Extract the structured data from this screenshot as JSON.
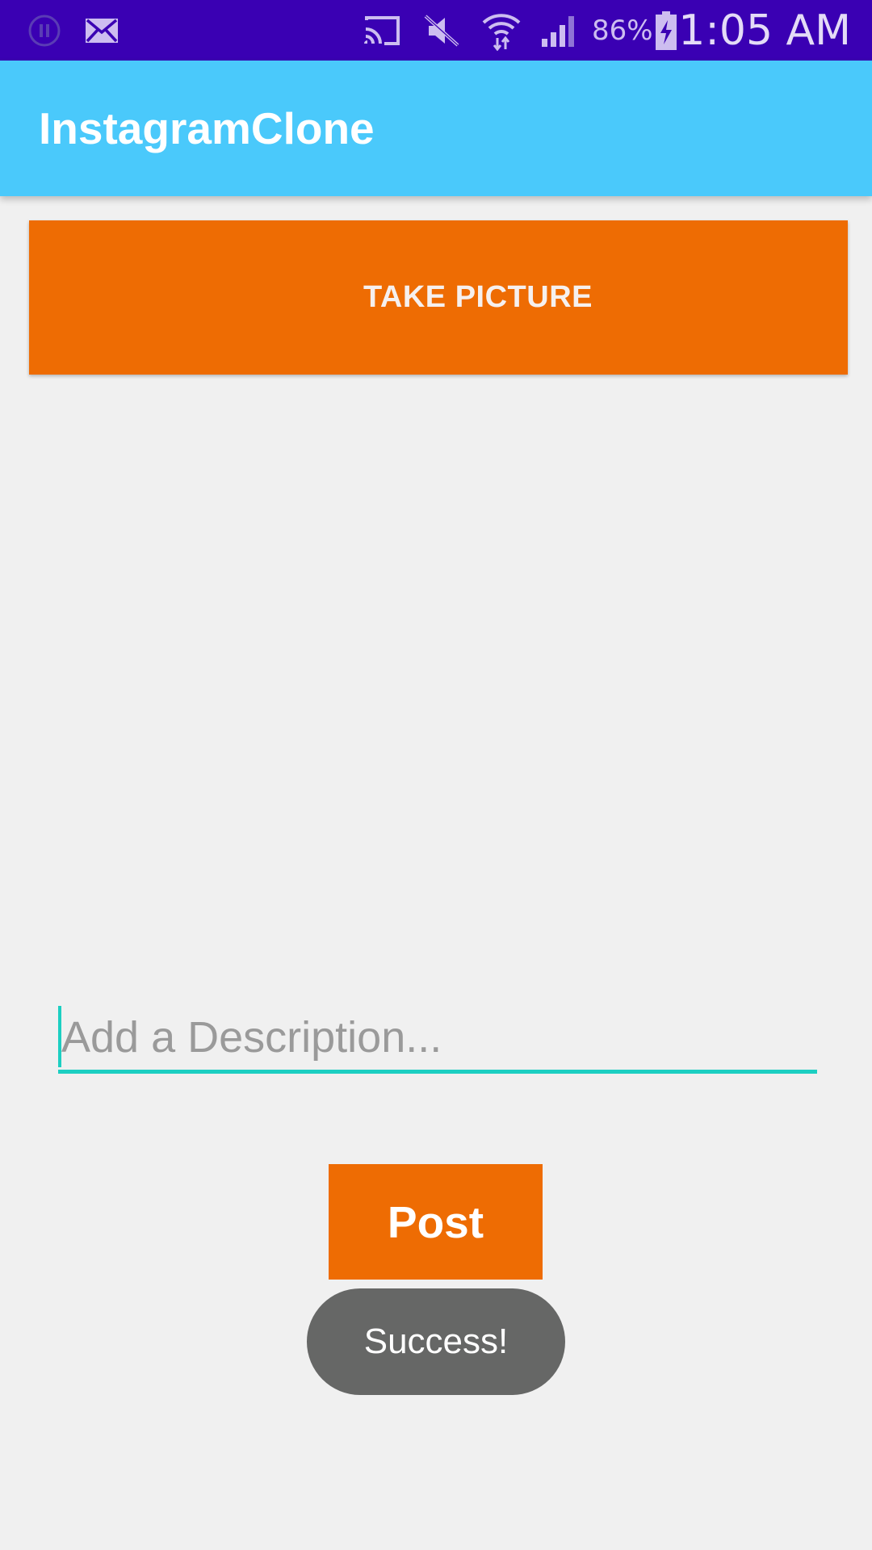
{
  "status_bar": {
    "battery_percent": "86%",
    "time": "1:05 AM",
    "icons": [
      "pause-circle-icon",
      "mail-icon",
      "cast-icon",
      "mute-icon",
      "wifi-icon",
      "signal-icon",
      "battery-charging-icon"
    ],
    "background_color": "#3a00b3"
  },
  "app_bar": {
    "title": "InstagramClone",
    "background_color": "#4ac9fb"
  },
  "main": {
    "take_picture_label": "TAKE PICTURE",
    "description_placeholder": "Add a Description...",
    "description_value": "",
    "post_label": "Post",
    "accent_color": "#ee6c03",
    "input_underline_color": "#1ccfc2"
  },
  "toast": {
    "message": "Success!"
  }
}
